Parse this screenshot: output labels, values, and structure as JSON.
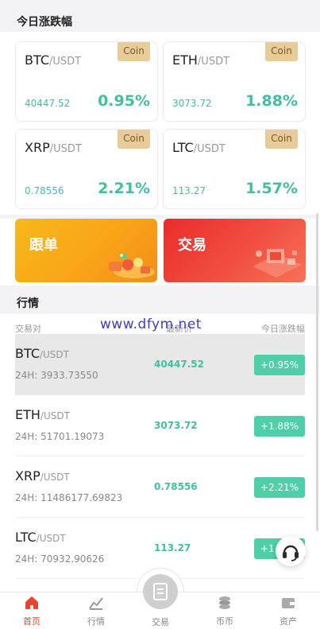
{
  "top_section": {
    "title": "今日涨跌幅"
  },
  "cards": [
    {
      "base": "BTC",
      "quote": "/USDT",
      "price": "40447.52",
      "change": "0.95%",
      "tag": "Coin"
    },
    {
      "base": "ETH",
      "quote": "/USDT",
      "price": "3073.72",
      "change": "1.88%",
      "tag": "Coin"
    },
    {
      "base": "XRP",
      "quote": "/USDT",
      "price": "0.78556",
      "change": "2.21%",
      "tag": "Coin"
    },
    {
      "base": "LTC",
      "quote": "/USDT",
      "price": "113.27",
      "change": "1.57%",
      "tag": "Coin"
    }
  ],
  "banners": {
    "follow": "跟单",
    "trade": "交易"
  },
  "market": {
    "title": "行情",
    "col_pair": "交易对",
    "col_price": "最新价",
    "col_change": "今日涨跌幅",
    "watermark": "www.dfym.net",
    "rows": [
      {
        "base": "BTC",
        "quote": "/USDT",
        "volume": "24H: 3933.73550",
        "price": "40447.52",
        "change": "+0.95%"
      },
      {
        "base": "ETH",
        "quote": "/USDT",
        "volume": "24H: 51701.19073",
        "price": "3073.72",
        "change": "+1.88%"
      },
      {
        "base": "XRP",
        "quote": "/USDT",
        "volume": "24H: 11486177.69823",
        "price": "0.78556",
        "change": "+2.21%"
      },
      {
        "base": "LTC",
        "quote": "/USDT",
        "volume": "24H: 70932.90626",
        "price": "113.27",
        "change": "+1.57%"
      }
    ]
  },
  "tabbar": {
    "home": "首页",
    "market": "行情",
    "trade": "交易",
    "coins": "币币",
    "assets": "资产"
  },
  "colors": {
    "accent": "#e8462c",
    "up": "#3fc0a0",
    "pill": "#4ecfa8",
    "tag": "#e7cc9a"
  },
  "icons": [
    "home-icon",
    "chart-icon",
    "trade-doc-icon",
    "coins-icon",
    "wallet-icon",
    "headset-icon"
  ]
}
